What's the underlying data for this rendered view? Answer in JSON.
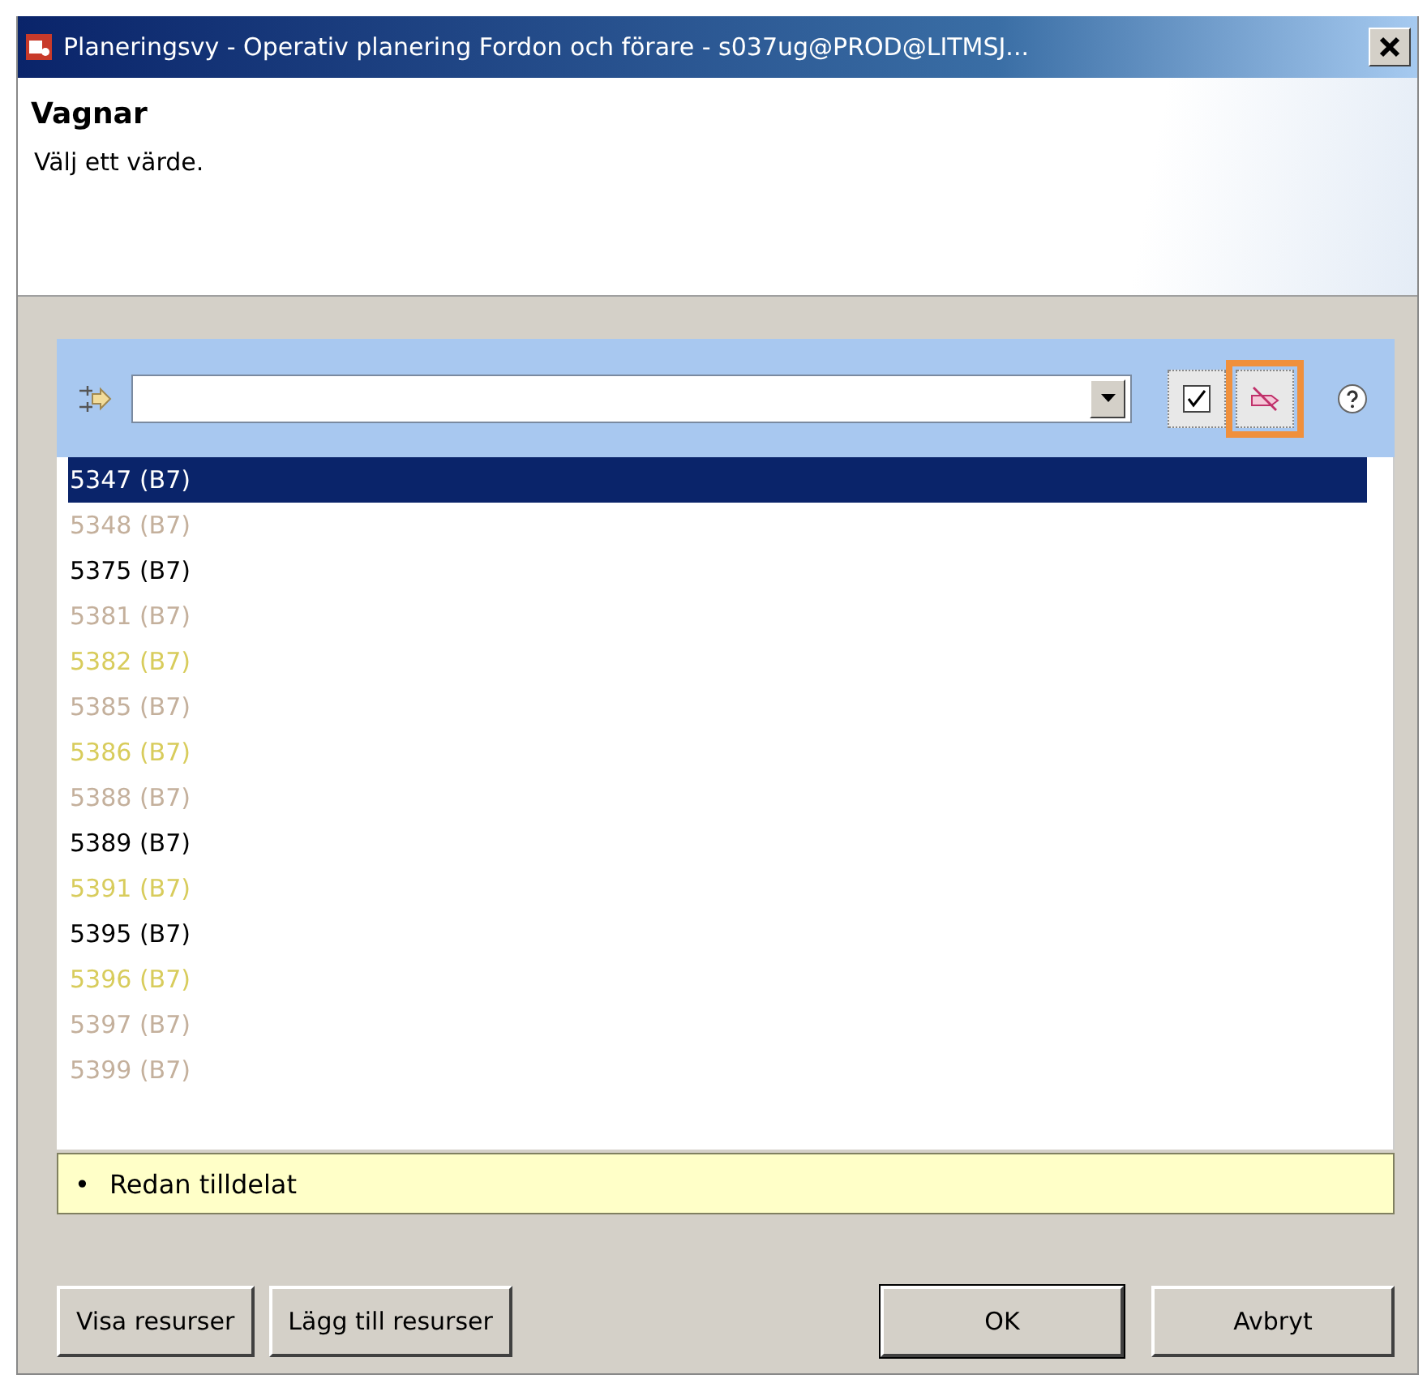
{
  "window": {
    "title": "Planeringsvy - Operativ planering Fordon och förare - s037ug@PROD@LITMSJ..."
  },
  "header": {
    "title": "Vagnar",
    "subtitle": "Välj ett värde."
  },
  "filter": {
    "toggles": [
      {
        "kind": "check",
        "highlighted": false
      },
      {
        "kind": "strike",
        "highlighted": true
      }
    ]
  },
  "items": [
    {
      "label": "5347 (B7)",
      "selected": true
    },
    {
      "label": "5348 (B7)",
      "selected": false,
      "color": "#c4b09c"
    },
    {
      "label": "5375 (B7)",
      "selected": false,
      "color": "#000000"
    },
    {
      "label": "5381 (B7)",
      "selected": false,
      "color": "#c4b09c"
    },
    {
      "label": "5382 (B7)",
      "selected": false,
      "color": "#d8cc5c"
    },
    {
      "label": "5385 (B7)",
      "selected": false,
      "color": "#c4b09c"
    },
    {
      "label": "5386 (B7)",
      "selected": false,
      "color": "#d8cc5c"
    },
    {
      "label": "5388 (B7)",
      "selected": false,
      "color": "#c4b09c"
    },
    {
      "label": "5389 (B7)",
      "selected": false,
      "color": "#000000"
    },
    {
      "label": "5391 (B7)",
      "selected": false,
      "color": "#d8cc5c"
    },
    {
      "label": "5395 (B7)",
      "selected": false,
      "color": "#000000"
    },
    {
      "label": "5396 (B7)",
      "selected": false,
      "color": "#d8cc5c"
    },
    {
      "label": "5397 (B7)",
      "selected": false,
      "color": "#c4b09c"
    },
    {
      "label": "5399 (B7)",
      "selected": false,
      "color": "#c4b09c"
    }
  ],
  "legend": {
    "bullet": "•",
    "text": "Redan tilldelat"
  },
  "buttons_left": [
    "Visa resurser",
    "Lägg till resurser"
  ],
  "buttons_right": [
    {
      "label": "OK",
      "default": true
    },
    {
      "label": "Avbryt",
      "default": false
    }
  ]
}
